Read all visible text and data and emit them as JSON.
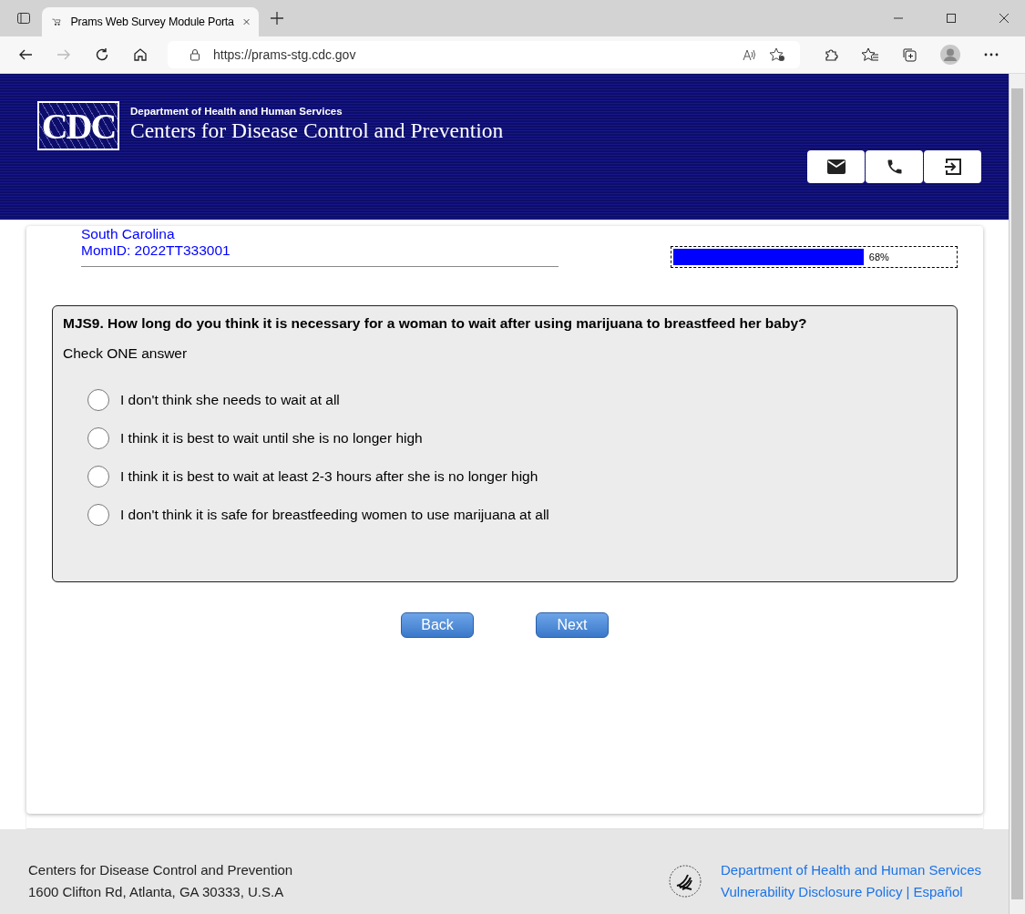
{
  "browser": {
    "tab_title": "Prams Web Survey Module Porta",
    "url": "https://prams-stg.cdc.gov"
  },
  "header": {
    "logo_text": "CDC",
    "department": "Department of Health and Human Services",
    "agency": "Centers for Disease Control and Prevention"
  },
  "respondent": {
    "state": "South Carolina",
    "mom_id": "MomID: 2022TT333001"
  },
  "progress": {
    "level": 0.68,
    "reading": "68%"
  },
  "question": {
    "text": "MJS9. How long do you think it is necessary for a woman to wait after using marijuana to breastfeed her baby?",
    "instruction": "Check ONE answer",
    "options": [
      {
        "label": "I don't think she needs to wait at all",
        "selected": false
      },
      {
        "label": "I think it is best to wait until she is no longer high",
        "selected": false
      },
      {
        "label": "I think it is best to wait at least 2-3 hours after she is no longer high",
        "selected": false
      },
      {
        "label": "I don't think it is safe for breastfeeding women to use marijuana at all",
        "selected": false
      }
    ]
  },
  "buttons": [
    "Back",
    "Next"
  ],
  "footer": {
    "org": "Centers for Disease Control and Prevention",
    "address": "1600 Clifton Rd, Atlanta, GA 30333, U.S.A",
    "links": [
      "Department of Health and Human Services",
      "Vulnerability Disclosure Policy",
      "Español"
    ],
    "separator": "|"
  }
}
